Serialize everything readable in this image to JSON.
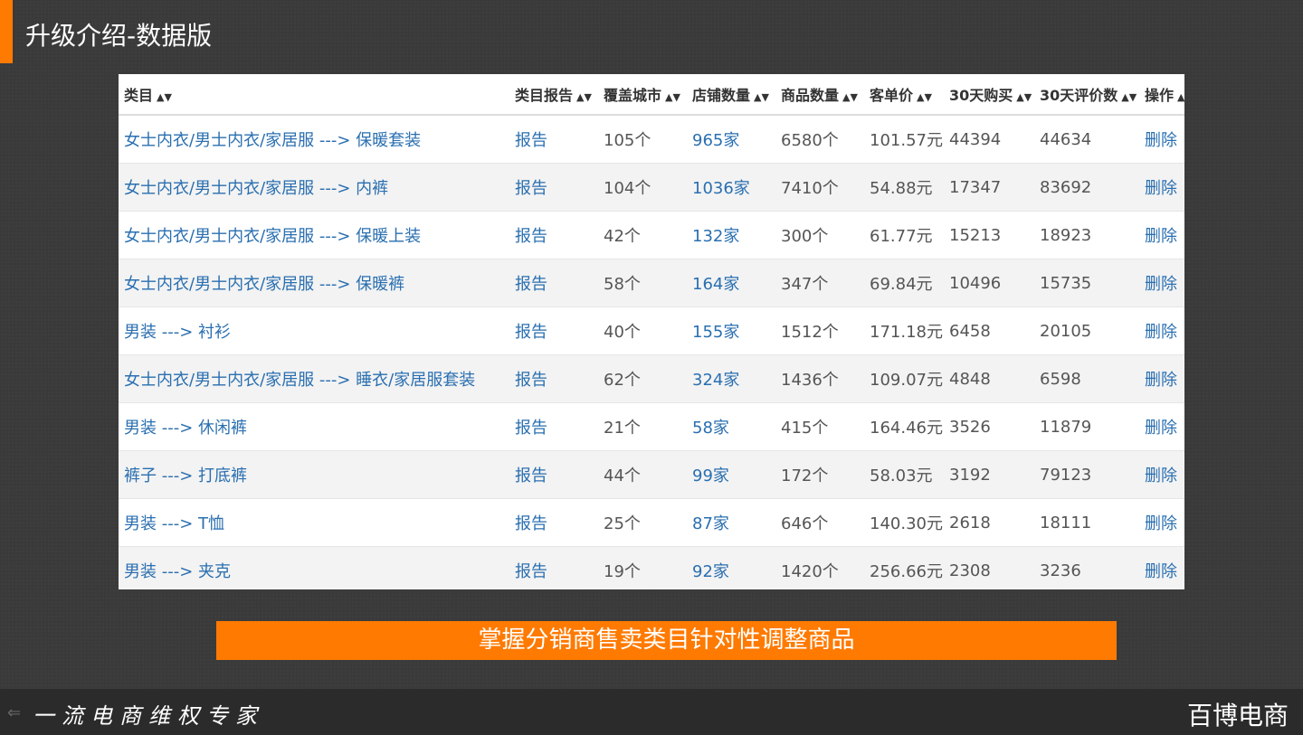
{
  "slide": {
    "title": "升级介绍-数据版",
    "banner": "掌握分销商售卖类目针对性调整商品",
    "slogan": "一流电商维权专家",
    "brand": "百博电商",
    "accent_color": "#ff7a00",
    "icons": {
      "sort": "sort-icon",
      "footer_arrow": "arrow-left-icon"
    }
  },
  "table": {
    "headers": [
      "类目",
      "类目报告",
      "覆盖城市",
      "店铺数量",
      "商品数量",
      "客单价",
      "30天购买",
      "30天评价数",
      "操作"
    ],
    "rows": [
      {
        "category": "女士内衣/男士内衣/家居服 ---> 保暖套装",
        "report": "报告",
        "cities": "105个",
        "shops": "965家",
        "products": "6580个",
        "price": "101.57元",
        "buy30": "44394",
        "review30": "44634",
        "action": "删除"
      },
      {
        "category": "女士内衣/男士内衣/家居服 ---> 内裤",
        "report": "报告",
        "cities": "104个",
        "shops": "1036家",
        "products": "7410个",
        "price": "54.88元",
        "buy30": "17347",
        "review30": "83692",
        "action": "删除"
      },
      {
        "category": "女士内衣/男士内衣/家居服 ---> 保暖上装",
        "report": "报告",
        "cities": "42个",
        "shops": "132家",
        "products": "300个",
        "price": "61.77元",
        "buy30": "15213",
        "review30": "18923",
        "action": "删除"
      },
      {
        "category": "女士内衣/男士内衣/家居服 ---> 保暖裤",
        "report": "报告",
        "cities": "58个",
        "shops": "164家",
        "products": "347个",
        "price": "69.84元",
        "buy30": "10496",
        "review30": "15735",
        "action": "删除"
      },
      {
        "category": "男装 ---> 衬衫",
        "report": "报告",
        "cities": "40个",
        "shops": "155家",
        "products": "1512个",
        "price": "171.18元",
        "buy30": "6458",
        "review30": "20105",
        "action": "删除"
      },
      {
        "category": "女士内衣/男士内衣/家居服 ---> 睡衣/家居服套装",
        "report": "报告",
        "cities": "62个",
        "shops": "324家",
        "products": "1436个",
        "price": "109.07元",
        "buy30": "4848",
        "review30": "6598",
        "action": "删除"
      },
      {
        "category": "男装 ---> 休闲裤",
        "report": "报告",
        "cities": "21个",
        "shops": "58家",
        "products": "415个",
        "price": "164.46元",
        "buy30": "3526",
        "review30": "11879",
        "action": "删除"
      },
      {
        "category": "裤子 ---> 打底裤",
        "report": "报告",
        "cities": "44个",
        "shops": "99家",
        "products": "172个",
        "price": "58.03元",
        "buy30": "3192",
        "review30": "79123",
        "action": "删除"
      },
      {
        "category": "男装 ---> T恤",
        "report": "报告",
        "cities": "25个",
        "shops": "87家",
        "products": "646个",
        "price": "140.30元",
        "buy30": "2618",
        "review30": "18111",
        "action": "删除"
      },
      {
        "category": "男装 ---> 夹克",
        "report": "报告",
        "cities": "19个",
        "shops": "92家",
        "products": "1420个",
        "price": "256.66元",
        "buy30": "2308",
        "review30": "3236",
        "action": "删除"
      }
    ]
  }
}
